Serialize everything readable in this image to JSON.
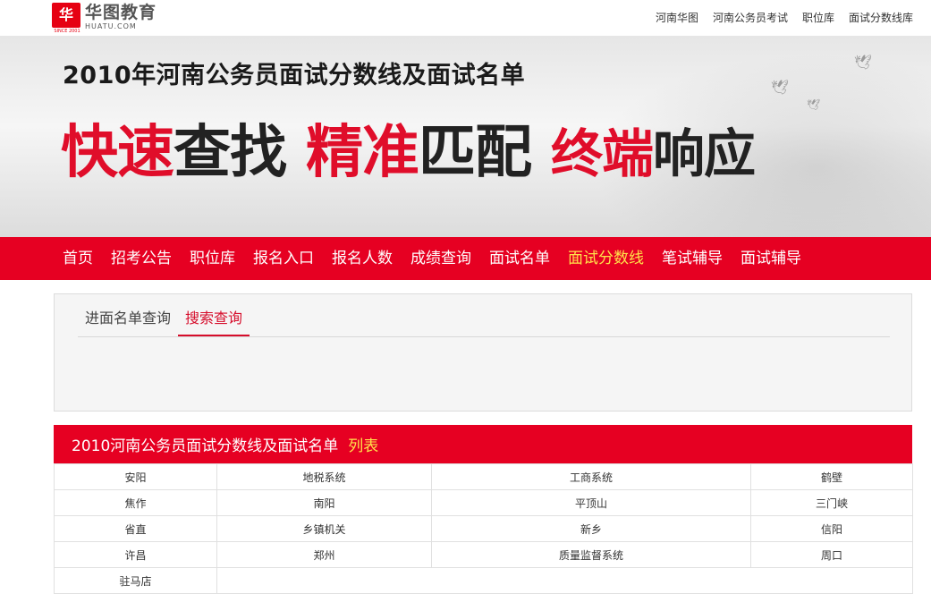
{
  "logo": {
    "mark": "华",
    "cn": "华图教育",
    "en": "HUATU.COM",
    "since": "SINCE 2001"
  },
  "top_links": [
    "河南华图",
    "河南公务员考试",
    "职位库",
    "面试分数线库"
  ],
  "banner": {
    "title": "2010年河南公务员面试分数线及面试名单",
    "slogan": [
      {
        "red": "快速",
        "dark": "查找"
      },
      {
        "red": "精准",
        "dark": "匹配"
      },
      {
        "red": "终端",
        "dark": "响应"
      }
    ]
  },
  "nav": {
    "items": [
      "首页",
      "招考公告",
      "职位库",
      "报名入口",
      "报名人数",
      "成绩查询",
      "面试名单",
      "面试分数线",
      "笔试辅导",
      "面试辅导"
    ],
    "active": "面试分数线"
  },
  "search": {
    "tabs": [
      "进面名单查询",
      "搜索查询"
    ],
    "active_tab": "搜索查询"
  },
  "list": {
    "title": "2010河南公务员面试分数线及面试名单",
    "suffix": "列表",
    "rows": [
      [
        "安阳",
        "地税系统",
        "工商系统",
        "鹤壁"
      ],
      [
        "焦作",
        "南阳",
        "平顶山",
        "三门峡"
      ],
      [
        "省直",
        "乡镇机关",
        "新乡",
        "信阳"
      ],
      [
        "许昌",
        "郑州",
        "质量监督系统",
        "周口"
      ],
      [
        "驻马店"
      ]
    ]
  },
  "colors": {
    "brand_red": "#e60022",
    "highlight_yellow": "#ffe24a",
    "slogan_red": "#e00d2a"
  }
}
